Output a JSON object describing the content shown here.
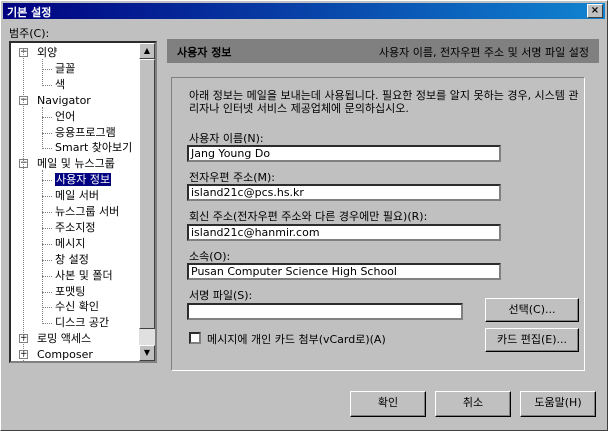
{
  "window": {
    "title": "기본 설정",
    "close_glyph": "×"
  },
  "category_label": "범주(C):",
  "tree": [
    {
      "label": "외양",
      "expander": "−"
    },
    {
      "label": "글꼴"
    },
    {
      "label": "색"
    },
    {
      "label": "Navigator",
      "expander": "−"
    },
    {
      "label": "언어"
    },
    {
      "label": "응용프로그램"
    },
    {
      "label": "Smart 찾아보기"
    },
    {
      "label": "메일 및 뉴스그룹",
      "expander": "−"
    },
    {
      "label": "사용자 정보",
      "selected": true
    },
    {
      "label": "메일 서버"
    },
    {
      "label": "뉴스그룹 서버"
    },
    {
      "label": "주소지정"
    },
    {
      "label": "메시지"
    },
    {
      "label": "창 설정"
    },
    {
      "label": "사본 및 폴더"
    },
    {
      "label": "포맷팅"
    },
    {
      "label": "수신 확인"
    },
    {
      "label": "디스크 공간"
    },
    {
      "label": "로밍 액세스",
      "expander": "+"
    },
    {
      "label": "Composer",
      "expander": "+"
    }
  ],
  "scrollbar": {
    "up": "▲",
    "down": "▼"
  },
  "header": {
    "title": "사용자 정보",
    "subtitle": "사용자 이름, 전자우편 주소 및 서명 파일 설정"
  },
  "info_text": "아래 정보는 메일을 보내는데 사용됩니다. 필요한 정보를 알지 못하는 경우, 시스템 관리자나 인터넷 서비스 제공업체에 문의하십시오.",
  "fields": {
    "name": {
      "label": "사용자 이름(N):",
      "value": "Jang Young Do"
    },
    "email": {
      "label": "전자우편 주소(M):",
      "value": "island21c@pcs.hs.kr"
    },
    "reply": {
      "label": "회신 주소(전자우편 주소와 다른 경우에만 필요)(R):",
      "value": "island21c@hanmir.com"
    },
    "org": {
      "label": "소속(O):",
      "value": "Pusan Computer Science High School"
    },
    "signature": {
      "label": "서명 파일(S):",
      "value": ""
    }
  },
  "buttons": {
    "choose": "선택(C)...",
    "edit_card": "카드 편집(E)...",
    "ok": "확인",
    "cancel": "취소",
    "help": "도움말(H)"
  },
  "vcard_checkbox": {
    "label": "메시지에 개인 카드 첨부(vCard로)(A)",
    "checked": false
  }
}
